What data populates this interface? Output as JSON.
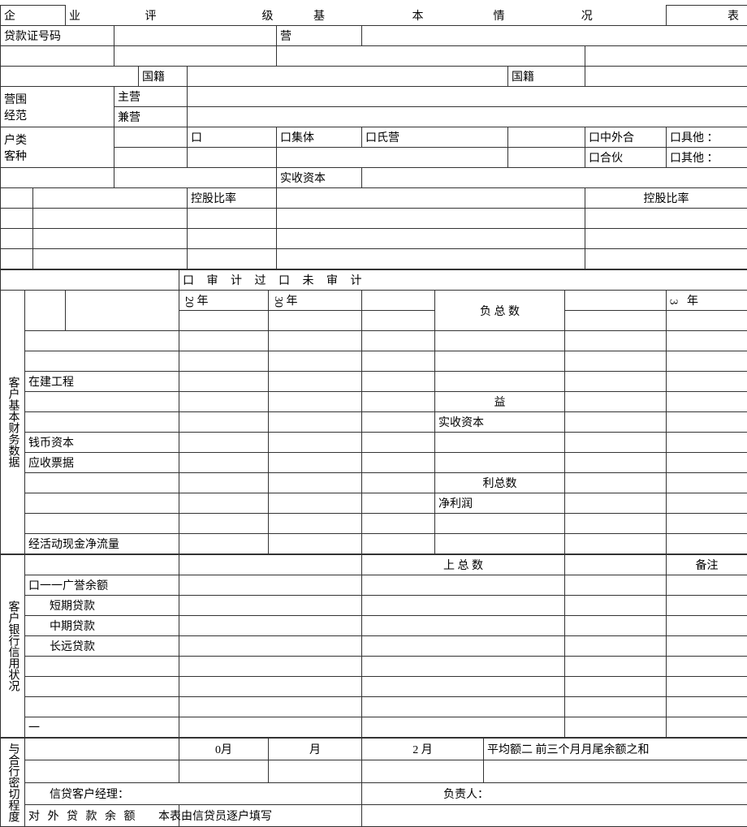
{
  "title": {
    "c1": "企",
    "c2": "业",
    "c3": "评",
    "c4": "级",
    "c5": "基",
    "c6": "本",
    "c7": "情",
    "c8": "况",
    "c9": "表"
  },
  "sec1": {
    "loanCert": "贷款证号码",
    "ying": "营",
    "nationality": "国籍",
    "yingwei": "营围",
    "jingfan": "经范",
    "zhuying": "主营",
    "jianying": "兼营",
    "hulei": "户类",
    "kezhong": "客种",
    "box": "口",
    "jiti": "口集体",
    "shiying": "口氏营",
    "zhongwaihe": "口中外合",
    "juta": "口具他 ：",
    "hehuo": "口合伙",
    "qita": "口其他 ：",
    "shishou": "实收资本",
    "konggu": "控股比率"
  },
  "sec2": {
    "audit": "口 审 计 过 口 未 审 计",
    "sideLabel": "客户基本财务数据",
    "year20": "20",
    "yearChar": "年",
    "year30": "30",
    "year3": "3",
    "fuzong": "负 总 数",
    "zaijian": "在建工程",
    "yi": "益",
    "shishouzb": "实收资本",
    "qianbi": "钱币资本",
    "yingshoupj": "应收票据",
    "lizong": "利总数",
    "jinglirun": "净利润",
    "jinghuodong": "经活动现金净流量"
  },
  "sec3": {
    "sideLabel": "客户银行信用状况",
    "shangzong": "上 总 数",
    "beizhu": "备注",
    "koubalance": "口一一广誉余额",
    "duanqi": "短期贷款",
    "zhongqi": "中期贷款",
    "changyuan": "长远贷款",
    "yi": "一"
  },
  "sec4": {
    "sideLabel": "与合行密切程度",
    "month0": "0月",
    "month": "月",
    "month2": "2 月",
    "pingjun": "平均额二  前三个月月尾余额之和",
    "xindai": "信贷客户经理：",
    "fuze": "负责人：",
    "duiwai": "对 外 贷 款 余 额",
    "note": "本表由信贷员逐户填写"
  }
}
